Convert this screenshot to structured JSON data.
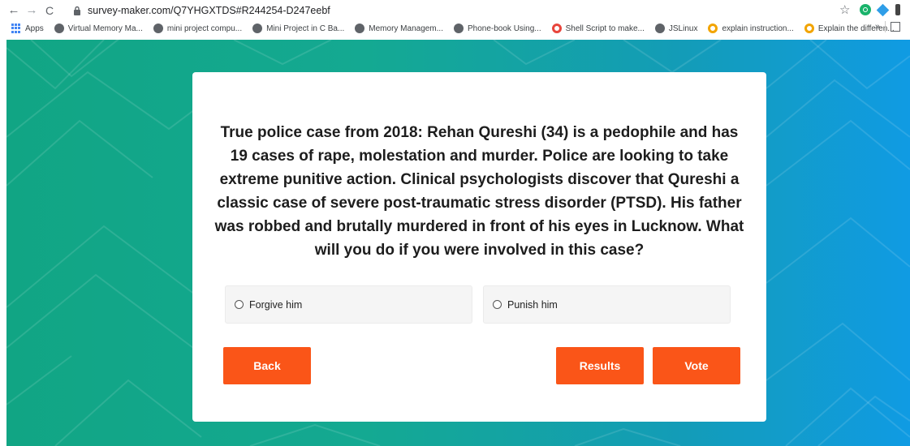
{
  "browser": {
    "nav": {
      "back": "←",
      "forward": "→",
      "reload": "C"
    },
    "url": "survey-maker.com/Q7YHGXTDS#R244254-D247eebf",
    "star": "☆",
    "bookmarks": [
      {
        "label": "Apps",
        "icon": "apps-grid-icon"
      },
      {
        "label": "Virtual Memory Ma...",
        "icon": "globe-icon"
      },
      {
        "label": "mini project compu...",
        "icon": "globe-icon"
      },
      {
        "label": "Mini Project in C Ba...",
        "icon": "globe-icon"
      },
      {
        "label": "Memory Managem...",
        "icon": "globe-icon"
      },
      {
        "label": "Phone-book Using...",
        "icon": "globe-icon"
      },
      {
        "label": "Shell Script to make...",
        "icon": "red-ring-icon"
      },
      {
        "label": "JSLinux",
        "icon": "globe-icon"
      },
      {
        "label": "explain instruction...",
        "icon": "q-icon"
      },
      {
        "label": "Explain the differen...",
        "icon": "q-icon"
      }
    ],
    "bookmarks_overflow": "»"
  },
  "survey": {
    "question": "True police case from 2018: Rehan Qureshi (34) is a pedophile and has 19 cases of rape, molestation and murder. Police are looking to take extreme punitive action. Clinical psychologists discover that Qureshi a classic case of severe post-traumatic stress disorder (PTSD). His father was robbed and brutally murdered in front of his eyes in Lucknow. What will you do if you were involved in this case?",
    "options": [
      "Forgive him",
      "Punish him"
    ],
    "back_label": "Back",
    "results_label": "Results",
    "vote_label": "Vote"
  },
  "colors": {
    "accent": "#fa5518",
    "background_start": "#11a584",
    "background_end": "#109be3"
  }
}
